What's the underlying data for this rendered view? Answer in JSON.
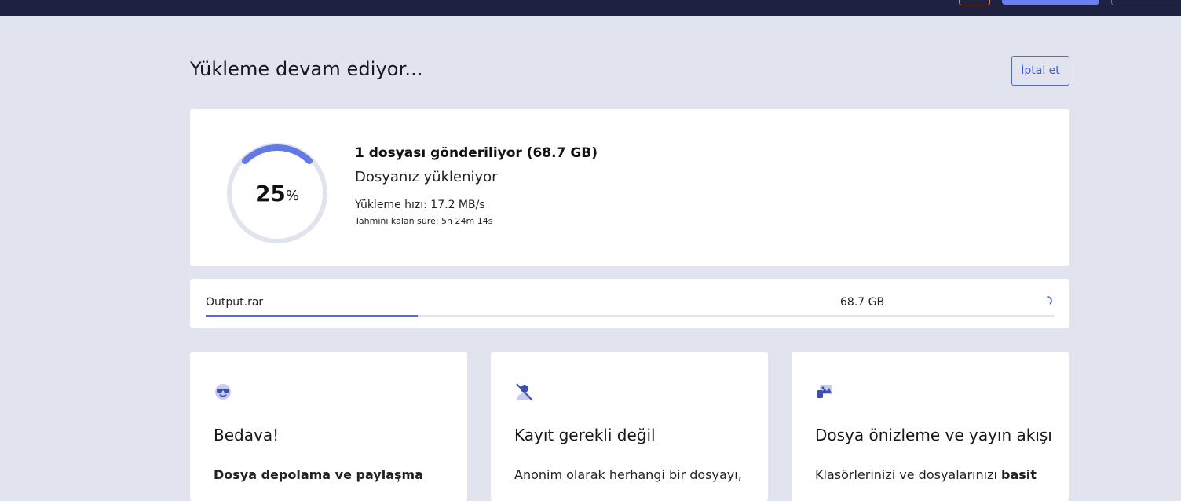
{
  "header": {
    "colors": {
      "bar": "#1e2140",
      "accent": "#6b7ef0",
      "warning": "#e8883a"
    }
  },
  "page": {
    "title": "Yükleme devam ediyor...",
    "cancel_label": "İptal et"
  },
  "progress": {
    "percent_value": "25",
    "percent_sign": "%",
    "fraction": 0.25,
    "send_title": "1 dosyası gönderiliyor (68.7 GB)",
    "status": "Dosyanız yükleniyor",
    "speed": "Yükleme hızı: 17.2 MB/s",
    "eta": "Tahmini kalan süre: 5h 24m 14s",
    "ring_color": "#6478e6",
    "track_color": "#e1e3ef"
  },
  "file": {
    "name": "Output.rar",
    "size": "68.7 GB",
    "fraction": 0.25
  },
  "features": [
    {
      "icon": "sunglasses-emoji-icon",
      "title": "Bedava!",
      "text_bold": "Dosya depolama ve paylaşma",
      "text": ""
    },
    {
      "icon": "anonymous-user-icon",
      "title": "Kayıt gerekli değil",
      "text": "Anonim olarak herhangi bir dosyayı,",
      "text_bold": ""
    },
    {
      "icon": "media-preview-icon",
      "title": "Dosya önizleme ve yayın akışı",
      "text": "Klasörlerinizi ve dosyalarınızı ",
      "text_bold": "basit"
    }
  ]
}
